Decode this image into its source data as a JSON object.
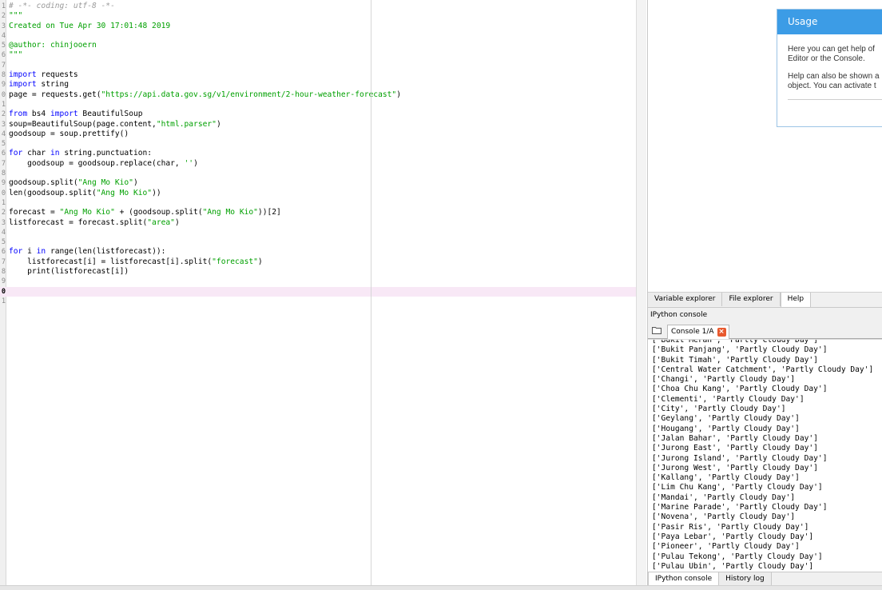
{
  "editor": {
    "current_line": 30,
    "lines": [
      {
        "n": "1",
        "t": [
          {
            "c": "comment",
            "s": "# -*- coding: utf-8 -*-"
          }
        ]
      },
      {
        "n": "2",
        "t": [
          {
            "c": "string",
            "s": "\"\"\""
          }
        ]
      },
      {
        "n": "3",
        "t": [
          {
            "c": "string",
            "s": "Created on Tue Apr 30 17:01:48 2019"
          }
        ]
      },
      {
        "n": "4",
        "t": []
      },
      {
        "n": "5",
        "t": [
          {
            "c": "string",
            "s": "@author: chinjooern"
          }
        ]
      },
      {
        "n": "6",
        "t": [
          {
            "c": "string",
            "s": "\"\"\""
          }
        ]
      },
      {
        "n": "7",
        "t": []
      },
      {
        "n": "8",
        "t": [
          {
            "c": "keyword",
            "s": "import"
          },
          {
            "c": "",
            "s": " requests"
          }
        ]
      },
      {
        "n": "9",
        "t": [
          {
            "c": "keyword",
            "s": "import"
          },
          {
            "c": "",
            "s": " string"
          }
        ]
      },
      {
        "n": "0",
        "t": [
          {
            "c": "",
            "s": "page = requests.get("
          },
          {
            "c": "string",
            "s": "\"https://api.data.gov.sg/v1/environment/2-hour-weather-forecast\""
          },
          {
            "c": "",
            "s": ")"
          }
        ]
      },
      {
        "n": "1",
        "t": []
      },
      {
        "n": "2",
        "t": [
          {
            "c": "keyword",
            "s": "from"
          },
          {
            "c": "",
            "s": " bs4 "
          },
          {
            "c": "keyword",
            "s": "import"
          },
          {
            "c": "",
            "s": " BeautifulSoup"
          }
        ]
      },
      {
        "n": "3",
        "t": [
          {
            "c": "",
            "s": "soup=BeautifulSoup(page.content,"
          },
          {
            "c": "string",
            "s": "\"html.parser\""
          },
          {
            "c": "",
            "s": ")"
          }
        ]
      },
      {
        "n": "4",
        "t": [
          {
            "c": "",
            "s": "goodsoup = soup.prettify()"
          }
        ]
      },
      {
        "n": "5",
        "t": []
      },
      {
        "n": "6",
        "t": [
          {
            "c": "keyword",
            "s": "for"
          },
          {
            "c": "",
            "s": " char "
          },
          {
            "c": "keyword",
            "s": "in"
          },
          {
            "c": "",
            "s": " string.punctuation:"
          }
        ]
      },
      {
        "n": "7",
        "t": [
          {
            "c": "",
            "s": "    goodsoup = goodsoup.replace(char, "
          },
          {
            "c": "string",
            "s": "''"
          },
          {
            "c": "",
            "s": ")"
          }
        ]
      },
      {
        "n": "8",
        "t": []
      },
      {
        "n": "9",
        "t": [
          {
            "c": "",
            "s": "goodsoup.split("
          },
          {
            "c": "string",
            "s": "\"Ang Mo Kio\""
          },
          {
            "c": "",
            "s": ")"
          }
        ]
      },
      {
        "n": "0",
        "t": [
          {
            "c": "",
            "s": "len(goodsoup.split("
          },
          {
            "c": "string",
            "s": "\"Ang Mo Kio\""
          },
          {
            "c": "",
            "s": "))"
          }
        ]
      },
      {
        "n": "1",
        "t": []
      },
      {
        "n": "2",
        "t": [
          {
            "c": "",
            "s": "forecast = "
          },
          {
            "c": "string",
            "s": "\"Ang Mo Kio\""
          },
          {
            "c": "",
            "s": " + (goodsoup.split("
          },
          {
            "c": "string",
            "s": "\"Ang Mo Kio\""
          },
          {
            "c": "",
            "s": "))[2]"
          }
        ]
      },
      {
        "n": "3",
        "t": [
          {
            "c": "",
            "s": "listforecast = forecast.split("
          },
          {
            "c": "string",
            "s": "\"area\""
          },
          {
            "c": "",
            "s": ")"
          }
        ]
      },
      {
        "n": "4",
        "t": []
      },
      {
        "n": "5",
        "t": []
      },
      {
        "n": "6",
        "t": [
          {
            "c": "keyword",
            "s": "for"
          },
          {
            "c": "",
            "s": " i "
          },
          {
            "c": "keyword",
            "s": "in"
          },
          {
            "c": "",
            "s": " range(len(listforecast)):"
          }
        ]
      },
      {
        "n": "7",
        "t": [
          {
            "c": "",
            "s": "    listforecast[i] = listforecast[i].split("
          },
          {
            "c": "string",
            "s": "\"forecast\""
          },
          {
            "c": "",
            "s": ")"
          }
        ]
      },
      {
        "n": "8",
        "t": [
          {
            "c": "",
            "s": "    print(listforecast[i])"
          }
        ]
      },
      {
        "n": "9",
        "t": []
      },
      {
        "n": "0",
        "t": []
      },
      {
        "n": "1",
        "t": []
      }
    ]
  },
  "help": {
    "usage_title": "Usage",
    "para1_line1": "Here you can get help of",
    "para1_line2": "Editor or the Console.",
    "para2_line1": "Help can also be shown a",
    "para2_line2": "object. You can activate t"
  },
  "help_tabs": [
    "Variable explorer",
    "File explorer",
    "Help"
  ],
  "help_tabs_active": 2,
  "console": {
    "pane_title": "IPython console",
    "tab_label": "Console 1/A",
    "close_glyph": "×",
    "output": [
      "['Bukit Merah', 'Partly Cloudy Day']",
      "['Bukit Panjang', 'Partly Cloudy Day']",
      "['Bukit Timah', 'Partly Cloudy Day']",
      "['Central Water Catchment', 'Partly Cloudy Day']",
      "['Changi', 'Partly Cloudy Day']",
      "['Choa Chu Kang', 'Partly Cloudy Day']",
      "['Clementi', 'Partly Cloudy Day']",
      "['City', 'Partly Cloudy Day']",
      "['Geylang', 'Partly Cloudy Day']",
      "['Hougang', 'Partly Cloudy Day']",
      "['Jalan Bahar', 'Partly Cloudy Day']",
      "['Jurong East', 'Partly Cloudy Day']",
      "['Jurong Island', 'Partly Cloudy Day']",
      "['Jurong West', 'Partly Cloudy Day']",
      "['Kallang', 'Partly Cloudy Day']",
      "['Lim Chu Kang', 'Partly Cloudy Day']",
      "['Mandai', 'Partly Cloudy Day']",
      "['Marine Parade', 'Partly Cloudy Day']",
      "['Novena', 'Partly Cloudy Day']",
      "['Pasir Ris', 'Partly Cloudy Day']",
      "['Paya Lebar', 'Partly Cloudy Day']",
      "['Pioneer', 'Partly Cloudy Day']",
      "['Pulau Tekong', 'Partly Cloudy Day']",
      "['Pulau Ubin', 'Partly Cloudy Day']"
    ]
  },
  "bottom_tabs": [
    "IPython console",
    "History log"
  ],
  "bottom_tabs_active": 0,
  "colors": {
    "keyword": "#0000ff",
    "string": "#00a000",
    "comment": "#9a9a9a",
    "current_line": "#f8e8f6",
    "usage_header": "#3c9ce6",
    "close_button": "#e8592e"
  },
  "icons": {
    "console_toolbar": "folder-icon",
    "console_tab_close": "close-icon"
  }
}
